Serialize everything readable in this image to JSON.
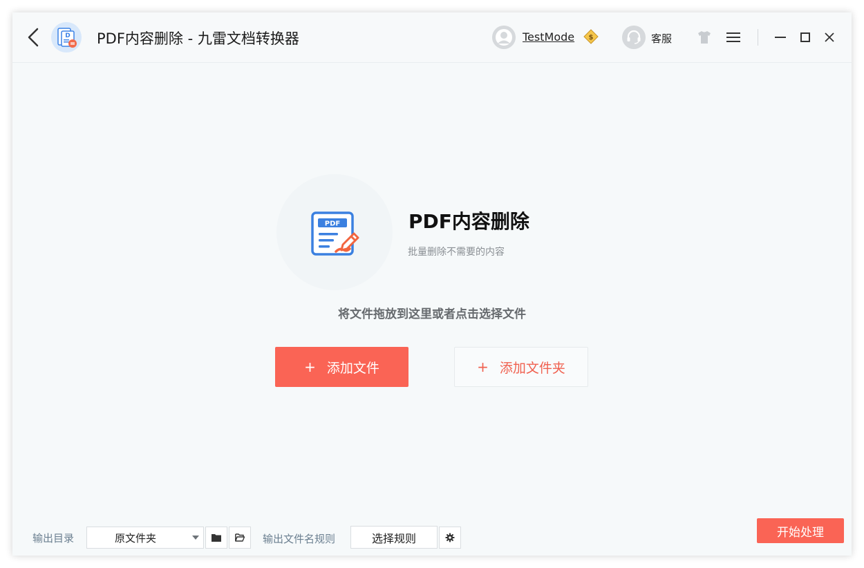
{
  "header": {
    "title": "PDF内容删除 - 九雷文档转换器",
    "username": "TestMode",
    "service_label": "客服"
  },
  "feature": {
    "title": "PDF内容删除",
    "subtitle": "批量删除不需要的内容",
    "icon_badge": "PDF",
    "drop_hint": "将文件拖放到这里或者点击选择文件"
  },
  "actions": {
    "plus": "+",
    "add_file": "添加文件",
    "add_folder": "添加文件夹"
  },
  "footer": {
    "output_dir_label": "输出目录",
    "output_dir_value": "原文件夹",
    "filename_rule_label": "输出文件名规则",
    "select_rule": "选择规则",
    "start": "开始处理"
  },
  "colors": {
    "accent": "#fa6455",
    "background": "#f6f9fa"
  },
  "icons": {
    "back": "chevron-left-icon",
    "app": "app-logo-icon",
    "vip": "vip-badge-icon",
    "skin": "tshirt-icon",
    "menu": "hamburger-menu-icon",
    "minimize": "minimize-icon",
    "maximize": "maximize-icon",
    "close": "close-icon",
    "folder": "folder-icon",
    "open_folder": "open-folder-icon",
    "settings": "gear-icon"
  }
}
